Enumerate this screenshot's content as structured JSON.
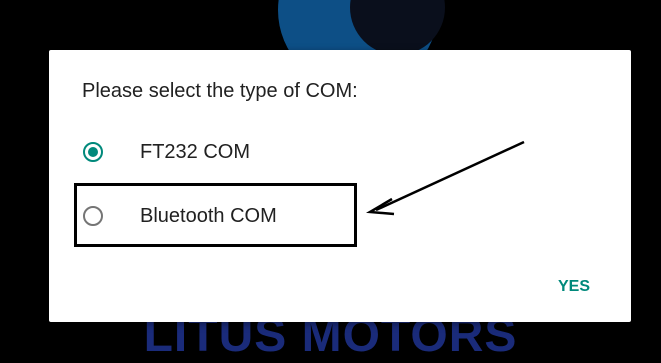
{
  "background": {
    "brand_text": "LITUS MOTORS",
    "brand_color": "#1a2b7a",
    "logo_color": "#0d4f86"
  },
  "dialog": {
    "title": "Please select the type of COM:",
    "options": [
      {
        "label": "FT232 COM",
        "selected": true
      },
      {
        "label": "Bluetooth COM",
        "selected": false
      }
    ],
    "confirm_label": "YES",
    "accent_color": "#00897b"
  },
  "annotation": {
    "highlighted_option": "Bluetooth COM"
  }
}
